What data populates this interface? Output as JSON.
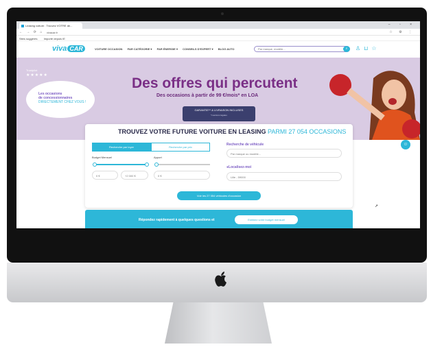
{
  "browser": {
    "tab_title": "Leasing voiture : Trouvez VOTRE de...",
    "window_controls": "–  ▫  ×",
    "url": "vivacar.fr",
    "bookmarks": [
      "Sites suggérés",
      "Importé depuis IE"
    ]
  },
  "site": {
    "logo_text": "viva",
    "logo_badge": "CAR",
    "menu": [
      "VOITURE OCCASION",
      "PAR CATÉGORIE ▾",
      "PAR ÉNERGIE ▾",
      "CONSEILS D'EXPERT ▾",
      "BLOG AUTO"
    ],
    "search_placeholder": "Par marque, modèle...",
    "trust_label": "Trustpilot",
    "trust_stars": "★★★★★",
    "bubble": {
      "line1": "Les occasions",
      "line2": "de concessionnaires",
      "line3": "DIRECTEMENT CHEZ VOUS !"
    },
    "hero_title": "Des offres qui percutent",
    "hero_subtitle": "Des occasions à partir de 99 €/mois* en LOA",
    "badge": {
      "title": "GARANTIE** & LIVRAISON INCLUSES",
      "sub": "*mentions légales"
    },
    "card": {
      "title": "TROUVEZ VOTRE FUTURE VOITURE EN LEASING",
      "title_accent": "PARMI 27 054 OCCASIONS",
      "tab_rent": "Recherche par loyer",
      "tab_price": "Recherche par prix",
      "budget_label": "Budget Mensuel",
      "apport_label": "Apport",
      "min_value": "0 €",
      "max_value": "+2 000 €",
      "apport_value": "0 €",
      "vehicle_label": "Recherche de véhicule",
      "vehicle_placeholder": "Par marque ou modèle...",
      "location_label": "Localisez-moi",
      "location_value": "Lille - 59000",
      "cta": "Voir les 27 054 véhicules d'occasion"
    },
    "banner": {
      "text": "Répondez rapidement à quelques questions et",
      "button": "Estimez votre budget mensuel"
    }
  }
}
